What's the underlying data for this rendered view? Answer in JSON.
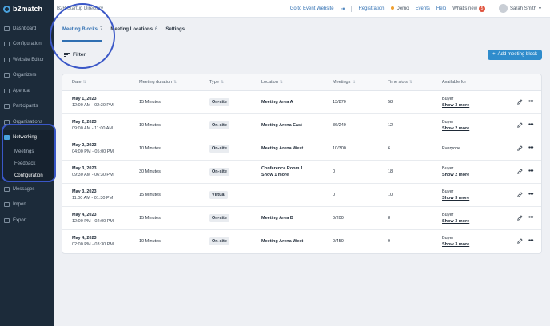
{
  "app": {
    "logo": "b2match"
  },
  "sidebar": {
    "items": [
      {
        "label": "Dashboard"
      },
      {
        "label": "Configuration"
      },
      {
        "label": "Website Editor"
      },
      {
        "label": "Organizers"
      },
      {
        "label": "Agenda"
      },
      {
        "label": "Participants"
      },
      {
        "label": "Organisations"
      }
    ],
    "networking": {
      "label": "Networking",
      "subitems": [
        {
          "label": "Meetings"
        },
        {
          "label": "Feedback"
        },
        {
          "label": "Configuration"
        }
      ]
    },
    "items_after": [
      {
        "label": "Messages"
      },
      {
        "label": "Import"
      },
      {
        "label": "Export"
      }
    ]
  },
  "topbar": {
    "event_title": "B2B Startup Directory",
    "go_to_event": "Go to Event Website",
    "registration": "Registration",
    "demo": "Demo",
    "events": "Events",
    "help": "Help",
    "whats_new": "What's new",
    "whats_new_count": "5",
    "user_name": "Sarah Smith"
  },
  "tabs": [
    {
      "label": "Meeting Blocks",
      "count": "7"
    },
    {
      "label": "Meeting Locations",
      "count": "6"
    },
    {
      "label": "Settings",
      "count": ""
    }
  ],
  "filter": {
    "label": "Filter"
  },
  "add_button": {
    "label": "Add meeting block"
  },
  "table": {
    "headers": [
      "Date",
      "Meeting duration",
      "Type",
      "Location",
      "Meetings",
      "Time slots",
      "Available for"
    ],
    "rows": [
      {
        "date": "May 1, 2023",
        "time": "12:00 AM - 02:30 PM",
        "duration": "15 Minutes",
        "type": "On-site",
        "location": "Meeting Area A",
        "location_more": "",
        "meetings": "13/870",
        "slots": "58",
        "available": "Buyer",
        "available_more": "Show 3 more"
      },
      {
        "date": "May 2, 2023",
        "time": "09:00 AM - 11:00 AM",
        "duration": "10 Minutes",
        "type": "On-site",
        "location": "Meeting Arena East",
        "location_more": "",
        "meetings": "36/240",
        "slots": "12",
        "available": "Buyer",
        "available_more": "Show 2 more"
      },
      {
        "date": "May 2, 2023",
        "time": "04:00 PM - 05:00 PM",
        "duration": "10 Minutes",
        "type": "On-site",
        "location": "Meeting Arena West",
        "location_more": "",
        "meetings": "10/300",
        "slots": "6",
        "available": "Everyone",
        "available_more": ""
      },
      {
        "date": "May 3, 2023",
        "time": "09:30 AM - 06:30 PM",
        "duration": "30 Minutes",
        "type": "On-site",
        "location": "Conference Room 1",
        "location_more": "Show 1 more",
        "meetings": "0",
        "slots": "18",
        "available": "Buyer",
        "available_more": "Show 2 more"
      },
      {
        "date": "May 3, 2023",
        "time": "11:00 AM - 01:30 PM",
        "duration": "15 Minutes",
        "type": "Virtual",
        "location": "",
        "location_more": "",
        "meetings": "0",
        "slots": "10",
        "available": "Buyer",
        "available_more": "Show 3 more"
      },
      {
        "date": "May 4, 2023",
        "time": "12:00 PM - 02:00 PM",
        "duration": "15 Minutes",
        "type": "On-site",
        "location": "Meeting Area B",
        "location_more": "",
        "meetings": "0/200",
        "slots": "8",
        "available": "Buyer",
        "available_more": "Show 3 more"
      },
      {
        "date": "May 4, 2023",
        "time": "02:00 PM - 03:30 PM",
        "duration": "10 Minutes",
        "type": "On-site",
        "location": "Meeting Arena West",
        "location_more": "",
        "meetings": "0/450",
        "slots": "9",
        "available": "Buyer",
        "available_more": "Show 3 more"
      }
    ]
  }
}
